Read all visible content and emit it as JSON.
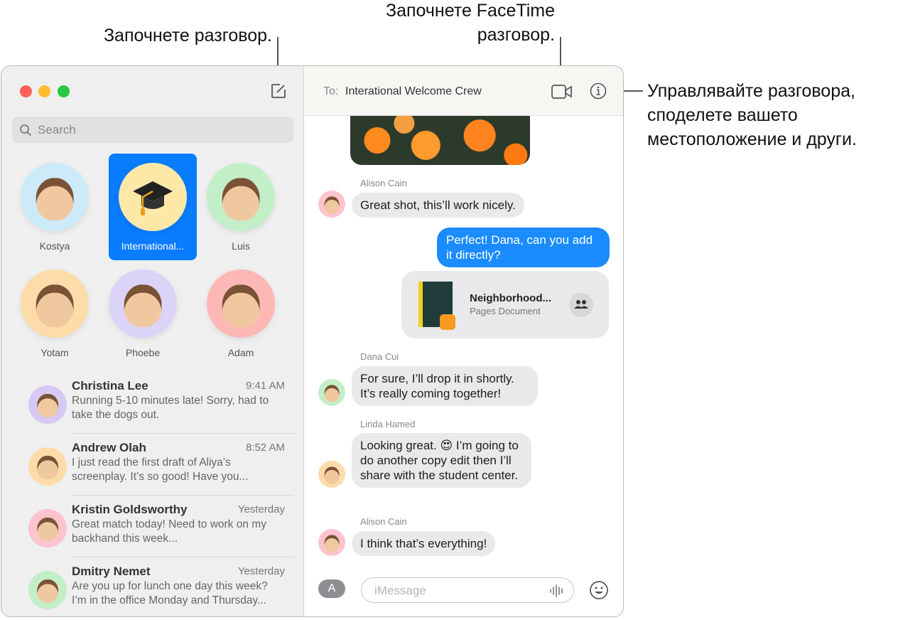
{
  "callouts": {
    "compose": "Започнете разговор.",
    "facetime_line1": "Започнете FaceTime",
    "facetime_line2": "разговор.",
    "info_line1": "Управлявайте разговора,",
    "info_line2": "споделете вашето",
    "info_line3": "местоположение и други."
  },
  "sidebar": {
    "search_placeholder": "Search",
    "pinned": [
      {
        "label": "Kostya",
        "color": "#cdeaf9"
      },
      {
        "label": "International...",
        "color": "#fde8a8",
        "selected": true
      },
      {
        "label": "Luis",
        "color": "#c2efc8"
      },
      {
        "label": "Yotam",
        "color": "#fddcaa"
      },
      {
        "label": "Phoebe",
        "color": "#dcd3f8"
      },
      {
        "label": "Adam",
        "color": "#fdb8b6"
      }
    ],
    "conversations": [
      {
        "name": "Christina Lee",
        "time": "9:41 AM",
        "preview": "Running 5-10 minutes late! Sorry, had to take the dogs out.",
        "color": "#d6c9f5"
      },
      {
        "name": "Andrew Olah",
        "time": "8:52 AM",
        "preview": "I just read the first draft of Aliya’s screenplay. It’s so good! Have you...",
        "color": "#fddcaa"
      },
      {
        "name": "Kristin Goldsworthy",
        "time": "Yesterday",
        "preview": "Great match today! Need to work on my backhand this week...",
        "color": "#fdc3cf"
      },
      {
        "name": "Dmitry Nemet",
        "time": "Yesterday",
        "preview": "Are you up for lunch one day this week? I’m in the office Monday and Thursday...",
        "color": "#c2efc8"
      }
    ]
  },
  "header": {
    "to_label": "To:",
    "recipient": "Interational Welcome Crew"
  },
  "messages": [
    {
      "sender": "Alison Cain",
      "text": "Great shot, this’ll work nicely."
    },
    {
      "text": "Perfect! Dana, can you add it directly?",
      "outgoing": true
    },
    {
      "doc_title": "Neighborhood...",
      "doc_type": "Pages Document"
    },
    {
      "sender": "Dana Cui",
      "text": "For sure, I’ll drop it in shortly. It’s really coming together!"
    },
    {
      "sender": "Linda Hamed",
      "text": "Looking great. 😍 I’m going to do another copy edit then I’ll share with the student center."
    },
    {
      "sender": "Alison Cain",
      "text": "I think that’s everything!"
    }
  ],
  "composer": {
    "placeholder": "iMessage"
  },
  "colors": {
    "accent": "#0a7cff",
    "outgoing_bubble": "#1a8cff",
    "incoming_bubble": "#e9e9eb"
  }
}
